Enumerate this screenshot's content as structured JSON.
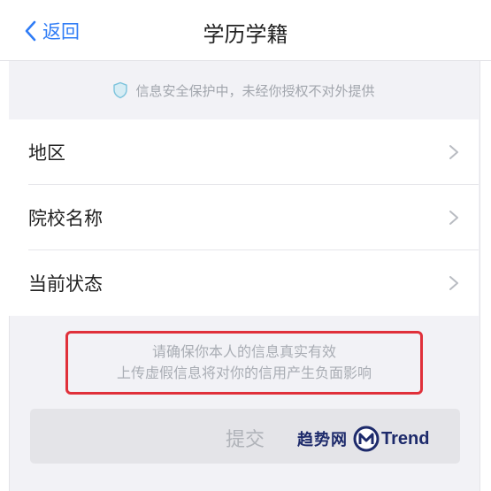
{
  "nav": {
    "back_label": "返回",
    "title": "学历学籍"
  },
  "notice": {
    "icon": "shield-icon",
    "text": "信息安全保护中，未经你授权不对外提供"
  },
  "list": {
    "items": [
      {
        "label": "地区"
      },
      {
        "label": "院校名称"
      },
      {
        "label": "当前状态"
      }
    ]
  },
  "warning": {
    "line1": "请确保你本人的信息真实有效",
    "line2": "上传虚假信息将对你的信用产生负面影响"
  },
  "submit": {
    "label": "提交",
    "enabled": false
  },
  "watermark": {
    "cn_text": "趋势网",
    "brand_text": "Trend"
  },
  "colors": {
    "accent": "#2f7cf6",
    "warning_border": "#e0303a",
    "watermark": "#1d2a6b"
  }
}
